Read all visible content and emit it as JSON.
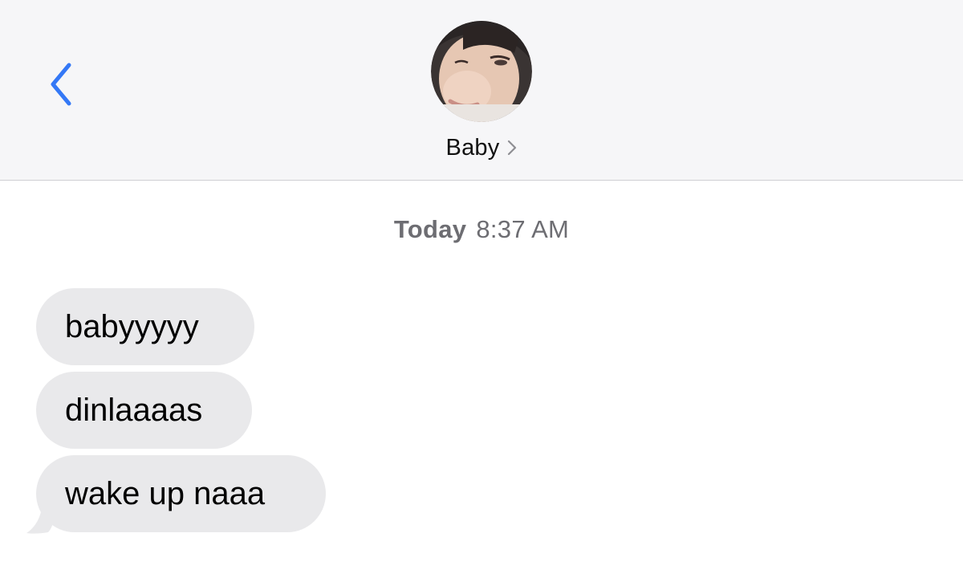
{
  "header": {
    "back_icon": "chevron-left-icon",
    "contact_name": "Baby",
    "contact_chevron_icon": "chevron-right-icon",
    "accent_color": "#3478f6"
  },
  "conversation": {
    "timestamp_day": "Today",
    "timestamp_time": "8:37 AM",
    "messages": [
      {
        "direction": "incoming",
        "text": "babyyyyy"
      },
      {
        "direction": "incoming",
        "text": "dinlaaaas"
      },
      {
        "direction": "incoming",
        "text": "wake up naaa"
      }
    ],
    "bubble_color": "#e9e9eb"
  }
}
